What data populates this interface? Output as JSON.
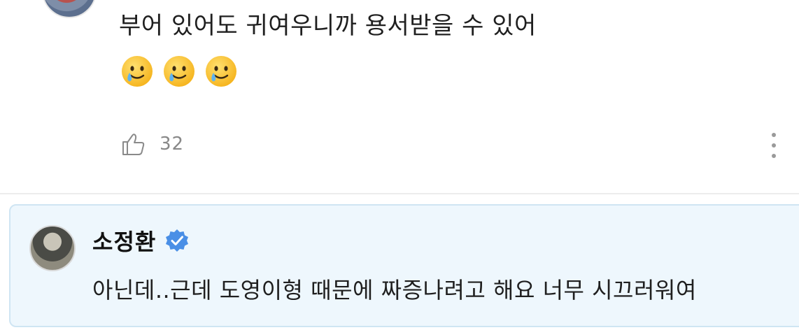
{
  "comment": {
    "text": "부어 있어도 귀여우니까 용서받을 수 있어",
    "emojis": [
      "smiling-face-with-tear-icon",
      "smiling-face-with-tear-icon",
      "smiling-face-with-tear-icon"
    ],
    "like_count": "32"
  },
  "reply": {
    "author": "소정환",
    "text": "아닌데..근데 도영이형 때문에 짜증나려고 해요 너무 시끄러워여"
  },
  "colors": {
    "reply_background": "#eef7fd",
    "reply_border": "#cfe5f3",
    "verified_badge": "#4a8fe6"
  }
}
